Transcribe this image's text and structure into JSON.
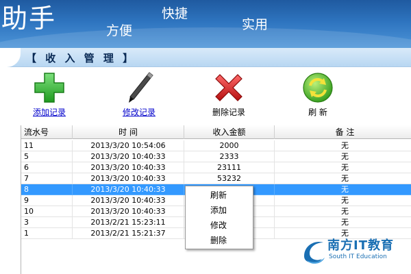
{
  "banner": {
    "helper_text": "助手",
    "word_convenient": "方便",
    "word_fast": "快捷",
    "word_practical": "实用"
  },
  "panel": {
    "title": "【 收 入 管 理 】"
  },
  "toolbar": {
    "add_label": "添加记录",
    "edit_label": "修改记录",
    "delete_label": "删除记录",
    "refresh_label": "刷 新"
  },
  "table": {
    "columns": [
      "流水号",
      "时 间",
      "收入金额",
      "备 注"
    ],
    "rows": [
      [
        "11",
        "2013/3/20  10:54:06",
        "2000",
        "无"
      ],
      [
        "5",
        "2013/3/20  10:40:33",
        "2333",
        "无"
      ],
      [
        "6",
        "2013/3/20  10:40:33",
        "23111",
        "无"
      ],
      [
        "7",
        "2013/3/20  10:40:33",
        "53232",
        "无"
      ],
      [
        "8",
        "2013/3/20  10:40:33",
        "",
        "无"
      ],
      [
        "9",
        "2013/3/20  10:40:33",
        "",
        "无"
      ],
      [
        "10",
        "2013/3/20  10:40:33",
        "",
        "无"
      ],
      [
        "3",
        "2013/2/21  15:23:11",
        "",
        "无"
      ],
      [
        "1",
        "2013/2/21  15:21:37",
        "",
        "无"
      ]
    ],
    "selected_row_index": 4
  },
  "context_menu": {
    "items": [
      "刷新",
      "添加",
      "修改",
      "删除"
    ]
  },
  "watermark": {
    "cn": "南方IT教育",
    "en": "South IT Education"
  },
  "colors": {
    "banner_blue": "#2e74bf",
    "selection_blue": "#3399ff",
    "add_green": "#3cc23c",
    "delete_red": "#d81e1e",
    "link_blue": "#0000cc"
  },
  "icons": {
    "add": "plus-icon",
    "edit": "pen-icon",
    "delete": "x-icon",
    "refresh": "refresh-icon"
  }
}
